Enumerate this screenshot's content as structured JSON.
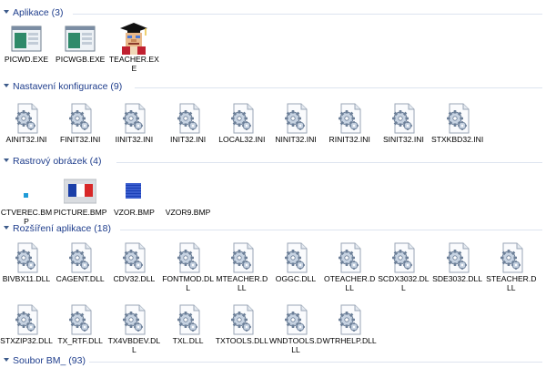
{
  "groups": [
    {
      "title": "Aplikace (3)",
      "icon": "app",
      "items": [
        {
          "label": "PICWD.EXE",
          "icon": "exe-window-icon"
        },
        {
          "label": "PICWGB.EXE",
          "icon": "exe-window-icon"
        },
        {
          "label": "TEACHER.EXE",
          "icon": "teacher-graduate-icon"
        }
      ]
    },
    {
      "title": "Nastavení konfigurace (9)",
      "icon": "ini",
      "items": [
        {
          "label": "AINIT32.INI",
          "icon": "ini-gear-icon"
        },
        {
          "label": "FINIT32.INI",
          "icon": "ini-gear-icon"
        },
        {
          "label": "IINIT32.INI",
          "icon": "ini-gear-icon"
        },
        {
          "label": "INIT32.INI",
          "icon": "ini-gear-icon"
        },
        {
          "label": "LOCAL32.INI",
          "icon": "ini-gear-icon"
        },
        {
          "label": "NINIT32.INI",
          "icon": "ini-gear-icon"
        },
        {
          "label": "RINIT32.INI",
          "icon": "ini-gear-icon"
        },
        {
          "label": "SINIT32.INI",
          "icon": "ini-gear-icon"
        },
        {
          "label": "STXKBD32.INI",
          "icon": "ini-gear-icon"
        }
      ]
    },
    {
      "title": "Rastrový obrázek (4)",
      "icon": "bmp",
      "items": [
        {
          "label": "CTVEREC.BMP",
          "icon": "small-square-bitmap-icon"
        },
        {
          "label": "PICTURE.BMP",
          "icon": "french-flag-bitmap-icon"
        },
        {
          "label": "VZOR.BMP",
          "icon": "blue-pattern-bitmap-icon"
        },
        {
          "label": "VZOR9.BMP",
          "icon": "blank-bitmap-icon"
        }
      ]
    },
    {
      "title": "Rozšíření aplikace (18)",
      "icon": "dll",
      "items": [
        {
          "label": "BIVBX11.DLL",
          "icon": "dll-gear-icon"
        },
        {
          "label": "CAGENT.DLL",
          "icon": "dll-gear-icon"
        },
        {
          "label": "CDV32.DLL",
          "icon": "dll-gear-icon"
        },
        {
          "label": "FONTMOD.DLL",
          "icon": "dll-gear-icon"
        },
        {
          "label": "MTEACHER.DLL",
          "icon": "dll-gear-icon"
        },
        {
          "label": "OGGC.DLL",
          "icon": "dll-gear-icon"
        },
        {
          "label": "OTEACHER.DLL",
          "icon": "dll-gear-icon"
        },
        {
          "label": "SCDX3032.DLL",
          "icon": "dll-gear-icon"
        },
        {
          "label": "SDE3032.DLL",
          "icon": "dll-gear-icon"
        },
        {
          "label": "STEACHER.DLL",
          "icon": "dll-gear-icon"
        },
        {
          "label": "STXZIP32.DLL",
          "icon": "dll-gear-icon"
        },
        {
          "label": "TX_RTF.DLL",
          "icon": "dll-gear-icon"
        },
        {
          "label": "TX4VBDEV.DLL",
          "icon": "dll-gear-icon"
        },
        {
          "label": "TXL.DLL",
          "icon": "dll-gear-icon"
        },
        {
          "label": "TXTOOLS.DLL",
          "icon": "dll-gear-icon"
        },
        {
          "label": "WNDTOOLS.DLL",
          "icon": "dll-gear-icon"
        },
        {
          "label": "WTRHELP.DLL",
          "icon": "dll-gear-icon"
        }
      ]
    },
    {
      "title": "Soubor BM_ (93)",
      "icon": "bm",
      "items": []
    }
  ],
  "colors": {
    "header_text": "#1e3d8c",
    "separator": "#dde4ef",
    "chevron": "#3c5a8a"
  }
}
